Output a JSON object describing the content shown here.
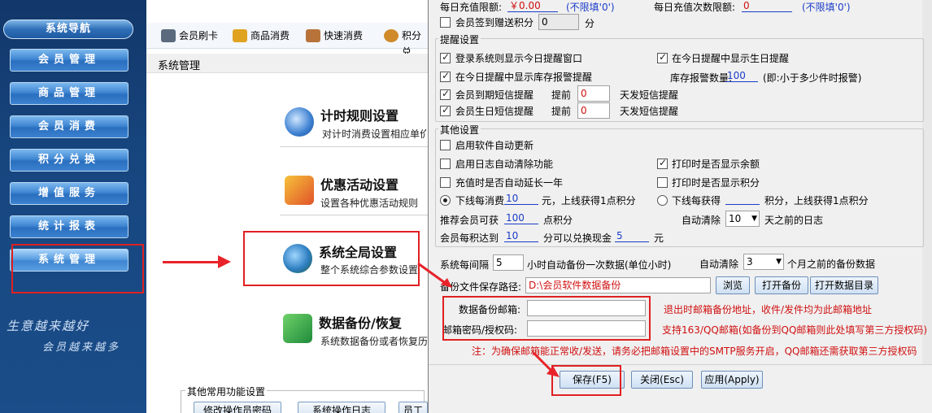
{
  "sidebar": {
    "header": "系统导航",
    "items": [
      {
        "label": "会员管理"
      },
      {
        "label": "商品管理"
      },
      {
        "label": "会员消费"
      },
      {
        "label": "积分兑换"
      },
      {
        "label": "增值服务"
      },
      {
        "label": "统计报表"
      },
      {
        "label": "系统管理"
      }
    ],
    "slogan_line1": "生意越来越好",
    "slogan_line2": "会员越来越多"
  },
  "toolbar": {
    "items": [
      {
        "label": "会员刷卡",
        "icon": "card-icon"
      },
      {
        "label": "商品消费",
        "icon": "money-icon"
      },
      {
        "label": "快速消费",
        "icon": "basket-icon"
      },
      {
        "label": "积分兑",
        "icon": "exchange-icon"
      }
    ]
  },
  "page": {
    "title": "系统管理",
    "features": [
      {
        "title": "计时规则设置",
        "desc": "对计时消费设置相应单价",
        "icon": "clock-icon"
      },
      {
        "title": "优惠活动设置",
        "desc": "设置各种优惠活动规则",
        "icon": "gift-icon"
      },
      {
        "title": "系统全局设置",
        "desc": "整个系统综合参数设置",
        "icon": "globe-gear-icon"
      },
      {
        "title": "数据备份/恢复",
        "desc": "系统数据备份或者恢复历",
        "icon": "backup-icon"
      }
    ],
    "other_group": {
      "legend": "其他常用功能设置",
      "buttons": [
        "修改操作员密码",
        "系统操作日志",
        "员工设置"
      ]
    }
  },
  "dialog": {
    "top": {
      "daily_recharge_limit_label": "每日充值限额:",
      "daily_recharge_limit_value": "￥0.00",
      "daily_recharge_limit_hint": "(不限填'0')",
      "daily_recharge_count_label": "每日充值次数限额:",
      "daily_recharge_count_value": "0",
      "daily_recharge_count_hint": "(不限填'0')",
      "signin_label": "会员签到赠送积分",
      "signin_value": "0",
      "signin_unit": "分"
    },
    "reminder": {
      "legend": "提醒设置",
      "login_reminder": "登录系统则显示今日提醒窗口",
      "birthday_in_today": "在今日提醒中显示生日提醒",
      "stock_alert": "在今日提醒中显示库存报警提醒",
      "stock_alert_qty_label": "库存报警数量:",
      "stock_alert_qty_value": "100",
      "stock_alert_qty_hint": "(即:小于多少件时报警)",
      "expire_sms": "会员到期短信提醒",
      "birthday_sms": "会员生日短信提醒",
      "ahead_label": "提前",
      "ahead_value": "0",
      "days_sms_label": "天发短信提醒"
    },
    "other": {
      "legend": "其他设置",
      "auto_update": "启用软件自动更新",
      "log_auto_clear": "启用日志自动清除功能",
      "print_balance": "打印时是否显示余额",
      "auto_extend": "充值时是否自动延长一年",
      "print_points": "打印时是否显示积分",
      "offline_spend_label": "下线每消费",
      "offline_spend_value": "10",
      "offline_spend_suffix": "元，上线获得1点积分",
      "offline_get_label": "下线每获得",
      "offline_get_value": "",
      "offline_get_suffix": "积分，上线获得1点积分",
      "referral_label": "推荐会员可获",
      "referral_value": "100",
      "referral_unit": "点积分",
      "auto_clear_label": "自动清除",
      "auto_clear_days": "10",
      "auto_clear_days_suffix": "天之前的日志",
      "points_reach_label": "会员每积达到",
      "points_reach_value": "10",
      "points_reach_mid": "分可以兑换现金",
      "points_cash_value": "5",
      "points_cash_unit": "元"
    },
    "backup": {
      "interval_label": "系统每间隔",
      "interval_value": "5",
      "interval_suffix": "小时自动备份一次数据(单位小时)",
      "auto_clear_label": "自动清除",
      "auto_clear_months": "3",
      "auto_clear_months_suffix": "个月之前的备份数据",
      "path_label": "备份文件保存路径:",
      "path_value": "D:\\会员软件数据备份",
      "browse_button": "浏览",
      "open_backup_button": "打开备份",
      "open_data_dir_button": "打开数据目录",
      "email_label": "数据备份邮箱:",
      "email_value": "",
      "password_label": "邮箱密码/授权码:",
      "password_value": "",
      "email_note": "退出时邮箱备份地址，收件/发件均为此邮箱地址",
      "qq_note": "支持163/QQ邮箱(如备份到QQ邮箱则此处填写第三方授权码)",
      "smtp_note": "注：为确保邮箱能正常收/发送，请务必把邮箱设置中的SMTP服务开启，QQ邮箱还需获取第三方授权码"
    },
    "buttons": {
      "save": "保存(F5)",
      "close": "关闭(Esc)",
      "apply": "应用(Apply)"
    }
  },
  "colors": {
    "sidebar_bg": "#17467f",
    "highlight_red": "#e02020",
    "hint_blue": "#1a3cc8"
  }
}
